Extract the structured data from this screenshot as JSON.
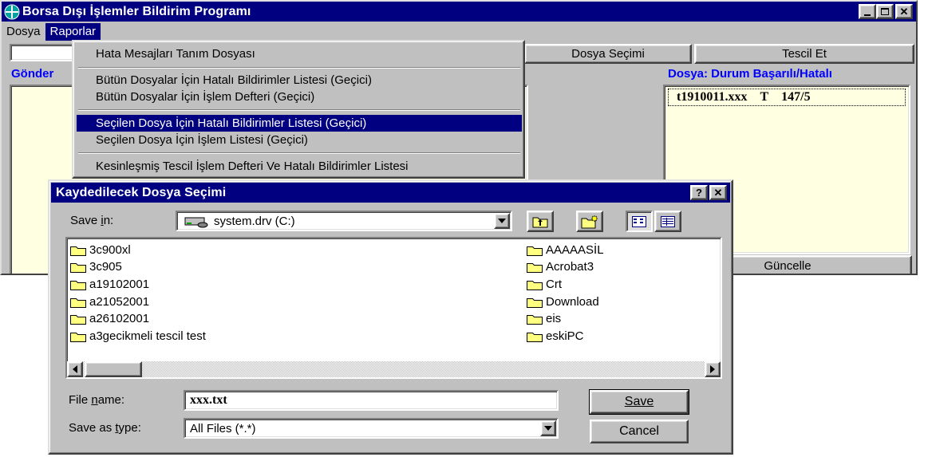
{
  "main_window": {
    "title": "Borsa Dışı İşlemler Bildirim Programı",
    "menu": [
      "Dosya",
      "Raporlar"
    ],
    "buttons": {
      "dosya_secimi": "Dosya Seçimi",
      "tescil_et": "Tescil Et",
      "guncelle": "Güncelle"
    },
    "labels": {
      "gonder": "Gönder",
      "dosya_durum": "Dosya: Durum Başarılı/Hatalı"
    },
    "file_list": [
      {
        "name": "t1910011.xxx",
        "status": "T",
        "count": "147/5"
      }
    ]
  },
  "raporlar_menu": {
    "items": [
      "Hata Mesajları Tanım Dosyası",
      "Bütün Dosyalar İçin Hatalı Bildirimler Listesi (Geçici)",
      "Bütün Dosyalar İçin İşlem Defteri (Geçici)",
      "Seçilen Dosya İçin Hatalı Bildirimler Listesi (Geçici)",
      "Seçilen Dosya İçin İşlem Listesi (Geçici)",
      "Kesinleşmiş Tescil İşlem Defteri Ve Hatalı Bildirimler Listesi"
    ],
    "highlighted_index": 3
  },
  "save_dialog": {
    "title": "Kaydedilecek Dosya Seçimi",
    "save_in_label": "Save in:",
    "save_in_value": "system.drv (C:)",
    "folders_left": [
      "3c900xl",
      "3c905",
      "a19102001",
      "a21052001",
      "a26102001",
      "a3gecikmeli tescil test"
    ],
    "folders_right": [
      "AAAAASİL",
      "Acrobat3",
      "Crt",
      "Download",
      "eis",
      "eskiPC"
    ],
    "file_name_label": "File name:",
    "file_name_value": "xxx.txt",
    "save_as_type_label": "Save as type:",
    "save_as_type_value": "All Files (*.*)",
    "save_button": "Save",
    "cancel_button": "Cancel"
  },
  "colors": {
    "titlebar": "#000080",
    "face": "#c0c0c0",
    "panel": "#ffffe1",
    "label_blue": "#0000ff"
  }
}
